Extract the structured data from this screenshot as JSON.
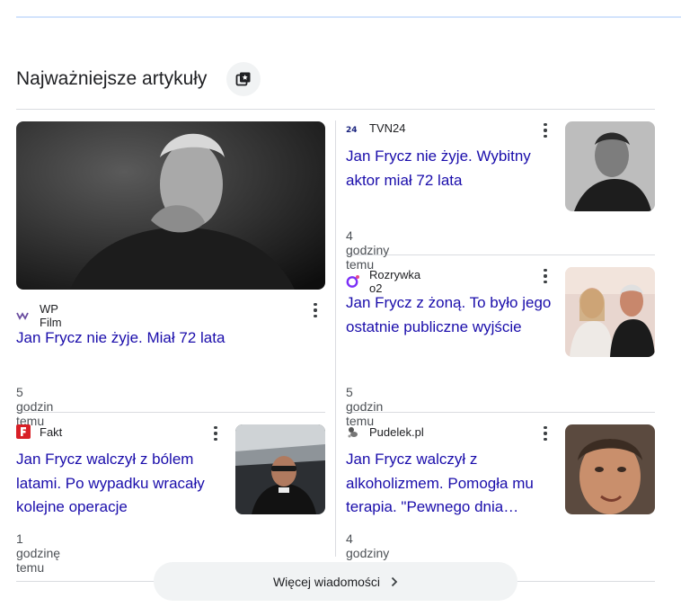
{
  "section": {
    "title": "Najważniejsze artykuły"
  },
  "icons": {
    "heading": "news-stack-icon",
    "more": "chevron-right-icon",
    "menu": "more-vert-icon"
  },
  "colors": {
    "link": "#1a0dab",
    "divider": "#dadce0",
    "top_rule": "#d2e3fc",
    "button_bg": "#f1f3f4",
    "fakt_red": "#d81f26",
    "o2_purple": "#7b2ff7"
  },
  "articles": [
    {
      "source": "WP Film",
      "logo": "wp-logo",
      "title": "Jan Frycz nie żyje. Miał 72 lata",
      "time": "5 godzin temu"
    },
    {
      "source": "TVN24",
      "logo": "tvn24-logo",
      "title": "Jan Frycz nie żyje. Wybitny aktor miał 72 lata",
      "time": "4 godziny temu"
    },
    {
      "source": "Rozrywka o2",
      "logo": "o2-logo",
      "title": "Jan Frycz z żoną. To było jego ostatnie publiczne wyjście",
      "time": "5 godzin temu"
    },
    {
      "source": "Fakt",
      "logo": "fakt-logo",
      "title": "Jan Frycz walczył z bólem latami. Po wypadku wracały kolejne operacje",
      "time": "1 godzinę temu"
    },
    {
      "source": "Pudelek.pl",
      "logo": "pudelek-logo",
      "title": "Jan Frycz walczył z alkoholizmem. Pomogła mu terapia. \"Pewnego dnia…",
      "time": "4 godziny temu"
    }
  ],
  "more_button": {
    "label": "Więcej wiadomości"
  }
}
